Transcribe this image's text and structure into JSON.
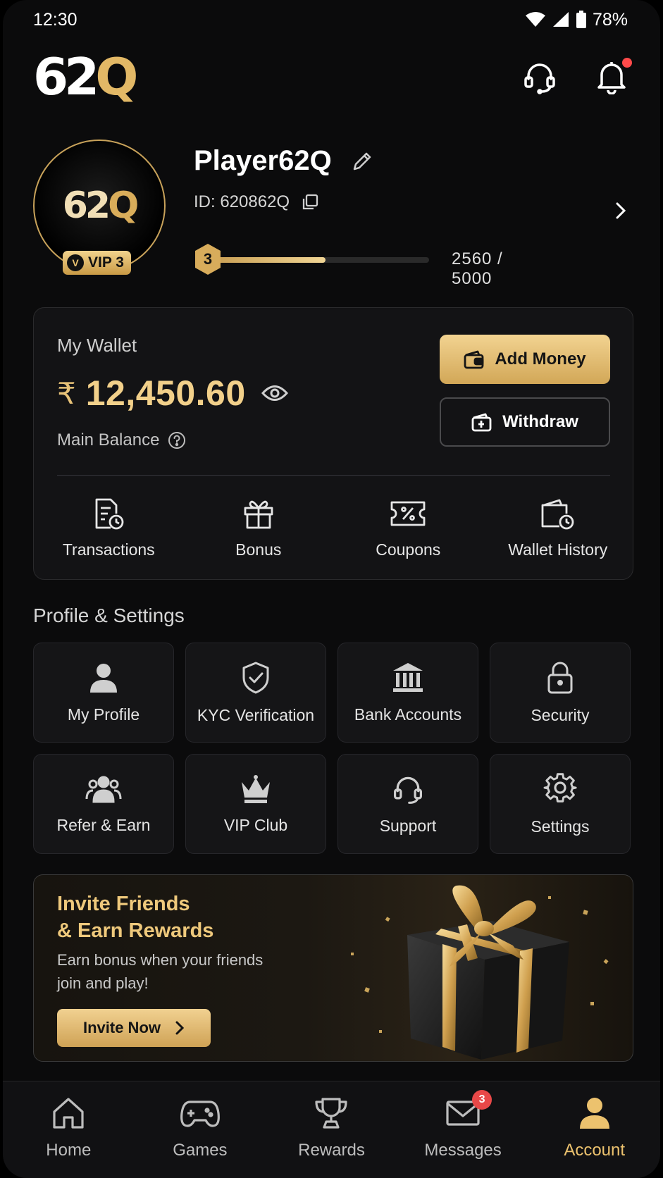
{
  "status_bar": {
    "time": "12:30",
    "battery": "78%"
  },
  "brand": {
    "logo_white": "62",
    "logo_gold": "Q"
  },
  "profile": {
    "username": "Player62Q",
    "id_text": "ID: 620862Q",
    "avatar_logo_white": "62",
    "avatar_logo_gold": "Q",
    "vip_badge": "VIP 3",
    "level": "3",
    "xp_text": "2560 / 5000",
    "xp_progress": 0.512
  },
  "wallet": {
    "title": "My Wallet",
    "currency": "₹",
    "balance": "12,450.60",
    "balance_label": "Main Balance",
    "add_money": "Add Money",
    "withdraw": "Withdraw",
    "actions": [
      "Transactions",
      "Bonus",
      "Coupons",
      "Wallet History"
    ]
  },
  "settings": {
    "title": "Profile & Settings",
    "items": [
      "My Profile",
      "KYC Verification",
      "Bank Accounts",
      "Security",
      "Refer & Earn",
      "VIP Club",
      "Support",
      "Settings"
    ]
  },
  "promo": {
    "title_line1": "Invite Friends",
    "title_line2": "& Earn Rewards",
    "subtitle_line1": "Earn bonus when your friends",
    "subtitle_line2": "join and play!",
    "button": "Invite Now"
  },
  "nav": {
    "items": [
      "Home",
      "Games",
      "Rewards",
      "Messages",
      "Account"
    ],
    "active": "Account",
    "messages_badge": "3"
  },
  "colors": {
    "accent_gold": "#ecc26e",
    "background": "#0b0b0c",
    "badge_red": "#e84848"
  }
}
